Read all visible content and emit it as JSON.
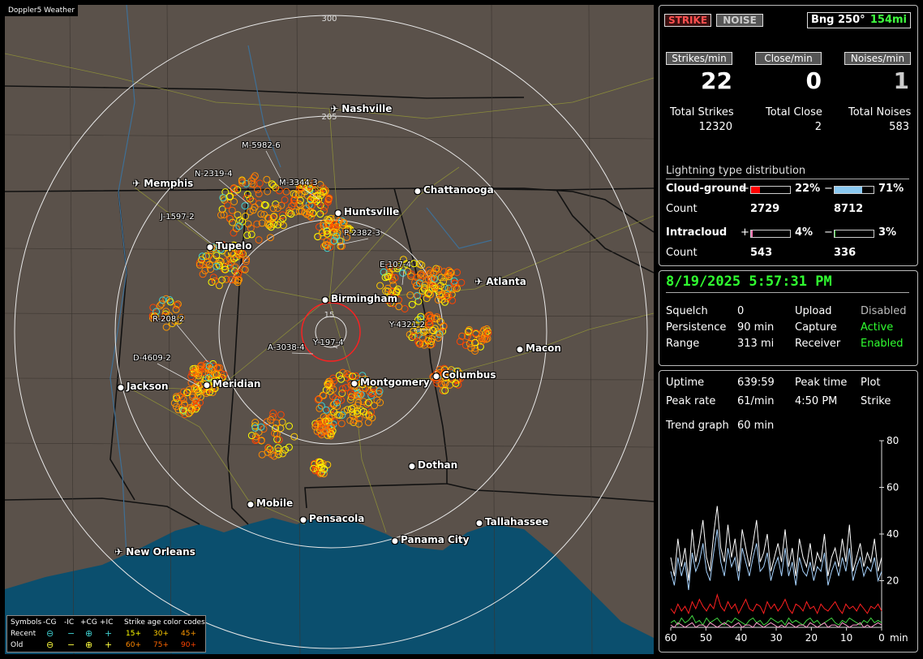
{
  "map": {
    "app_title": "Doppler5 Weather",
    "range_rings": [
      "300",
      "205",
      "15"
    ],
    "cities": [
      {
        "name": "Nashville",
        "type": "airport"
      },
      {
        "name": "Memphis",
        "type": "airport"
      },
      {
        "name": "Chattanooga",
        "type": "city"
      },
      {
        "name": "Huntsville",
        "type": "city"
      },
      {
        "name": "Tupelo",
        "type": "city"
      },
      {
        "name": "Atlanta",
        "type": "airport"
      },
      {
        "name": "Birmingham",
        "type": "city"
      },
      {
        "name": "Macon",
        "type": "city"
      },
      {
        "name": "Jackson",
        "type": "city"
      },
      {
        "name": "Meridian",
        "type": "city"
      },
      {
        "name": "Montgomery",
        "type": "city"
      },
      {
        "name": "Columbus",
        "type": "city"
      },
      {
        "name": "Dothan",
        "type": "city"
      },
      {
        "name": "Mobile",
        "type": "city"
      },
      {
        "name": "Pensacola",
        "type": "city"
      },
      {
        "name": "Tallahassee",
        "type": "city"
      },
      {
        "name": "Panama City",
        "type": "city"
      },
      {
        "name": "New Orleans",
        "type": "airport"
      }
    ],
    "storm_cells": [
      "M-5982-6",
      "N-2319-4",
      "M-3344-3",
      "J-1597-2",
      "P-2382-3",
      "E-107-4",
      "R-208-2",
      "D-4609-2",
      "Y-4321-2",
      "A-3038-4",
      "Y-197-4"
    ],
    "legend": {
      "symbols_label": "Symbols",
      "headers": [
        "-CG",
        "-IC",
        "+CG",
        "+IC"
      ],
      "recent_label": "Recent",
      "old_label": "Old",
      "age_title": "Strike age color codes",
      "recent_ages": [
        "15+",
        "30+",
        "45+"
      ],
      "old_ages": [
        "60+",
        "75+",
        "90+"
      ],
      "age_colors": [
        "#ffff00",
        "#ffcc00",
        "#ff9900",
        "#ff8800",
        "#ff6600",
        "#ff4400"
      ]
    }
  },
  "top": {
    "strike_btn": "STRIKE",
    "noise_btn": "NOISE",
    "bearing": "Bng 250°",
    "distance": "154mi",
    "strikes_min_label": "Strikes/min",
    "close_min_label": "Close/min",
    "noises_min_label": "Noises/min",
    "strikes_min": "22",
    "close_min": "0",
    "noises_min": "1",
    "total_strikes_label": "Total Strikes",
    "total_close_label": "Total Close",
    "total_noises_label": "Total Noises",
    "total_strikes": "12320",
    "total_close": "2",
    "total_noises": "583",
    "dist_title": "Lightning type distribution",
    "cg_label": "Cloud-ground",
    "ic_label": "Intracloud",
    "count_label": "Count",
    "plus": "+",
    "minus": "−",
    "cg_pos_pct": "22%",
    "cg_neg_pct": "71%",
    "ic_pos_pct": "4%",
    "ic_neg_pct": "3%",
    "cg_pos_frac": 0.22,
    "cg_neg_frac": 0.71,
    "ic_pos_frac": 0.04,
    "ic_neg_frac": 0.03,
    "cg_pos_count": "2729",
    "cg_neg_count": "8712",
    "ic_pos_count": "543",
    "ic_neg_count": "336"
  },
  "status": {
    "datetime": "8/19/2025 5:57:31 PM",
    "squelch_label": "Squelch",
    "squelch": "0",
    "upload_label": "Upload",
    "upload": "Disabled",
    "persistence_label": "Persistence",
    "persistence": "90 min",
    "capture_label": "Capture",
    "capture": "Active",
    "range_label": "Range",
    "range": "313 mi",
    "receiver_label": "Receiver",
    "receiver": "Enabled"
  },
  "trend": {
    "uptime_label": "Uptime",
    "uptime": "639:59",
    "peak_time_label": "Peak time",
    "plot_label": "Plot",
    "peak_rate_label": "Peak rate",
    "peak_rate": "61/min",
    "peak_time": "4:50 PM",
    "plot": "Strike",
    "trend_graph_label": "Trend graph",
    "trend_graph": "60 min"
  },
  "chart_data": {
    "type": "line",
    "x_ticks": [
      "60",
      "50",
      "40",
      "30",
      "20",
      "10",
      "0"
    ],
    "x_unit": "min",
    "y_ticks": [
      "80",
      "60",
      "40",
      "20"
    ],
    "ylim": [
      0,
      80
    ],
    "xlim": [
      60,
      0
    ],
    "series": [
      {
        "color": "#ffffff",
        "values": [
          30,
          22,
          38,
          26,
          34,
          20,
          42,
          28,
          36,
          46,
          30,
          24,
          40,
          52,
          34,
          28,
          44,
          30,
          38,
          24,
          42,
          34,
          26,
          36,
          46,
          28,
          32,
          40,
          24,
          30,
          36,
          28,
          42,
          26,
          34,
          22,
          38,
          30,
          26,
          36,
          24,
          32,
          28,
          40,
          22,
          30,
          34,
          26,
          38,
          28,
          44,
          24,
          30,
          36,
          26,
          32,
          28,
          38,
          24,
          30
        ]
      },
      {
        "color": "#a8d4ff",
        "values": [
          24,
          18,
          30,
          22,
          28,
          16,
          32,
          24,
          28,
          36,
          24,
          20,
          32,
          42,
          28,
          22,
          34,
          26,
          30,
          20,
          34,
          28,
          22,
          30,
          36,
          24,
          26,
          32,
          20,
          26,
          30,
          22,
          34,
          22,
          28,
          18,
          30,
          24,
          22,
          28,
          20,
          26,
          24,
          32,
          18,
          24,
          28,
          22,
          30,
          24,
          34,
          20,
          26,
          30,
          22,
          26,
          24,
          30,
          20,
          24
        ]
      },
      {
        "color": "#ff2020",
        "values": [
          8,
          6,
          10,
          7,
          9,
          6,
          11,
          8,
          12,
          9,
          7,
          10,
          8,
          14,
          9,
          7,
          11,
          8,
          10,
          6,
          9,
          12,
          8,
          7,
          10,
          9,
          6,
          11,
          8,
          10,
          7,
          9,
          12,
          8,
          6,
          10,
          9,
          7,
          11,
          8,
          9,
          6,
          10,
          8,
          7,
          9,
          11,
          8,
          6,
          10,
          8,
          9,
          7,
          10,
          8,
          6,
          9,
          8,
          10,
          7
        ]
      },
      {
        "color": "#40d040",
        "values": [
          2,
          3,
          1,
          4,
          2,
          3,
          5,
          2,
          3,
          1,
          4,
          2,
          3,
          4,
          2,
          1,
          3,
          2,
          4,
          3,
          2,
          1,
          3,
          4,
          2,
          3,
          1,
          2,
          4,
          3,
          2,
          3,
          1,
          4,
          2,
          3,
          2,
          1,
          3,
          4,
          2,
          3,
          1,
          2,
          3,
          4,
          2,
          1,
          3,
          2,
          4,
          3,
          2,
          1,
          3,
          2,
          4,
          2,
          3,
          2
        ]
      },
      {
        "color": "#ff9fd0",
        "values": [
          1,
          0,
          2,
          1,
          0,
          1,
          2,
          0,
          1,
          1,
          0,
          2,
          1,
          0,
          1,
          2,
          1,
          0,
          1,
          2,
          0,
          1,
          1,
          0,
          2,
          1,
          0,
          1,
          2,
          1,
          0,
          1,
          0,
          2,
          1,
          0,
          1,
          1,
          0,
          2,
          1,
          0,
          1,
          2,
          0,
          1,
          1,
          0,
          2,
          1,
          0,
          1,
          1,
          2,
          0,
          1,
          0,
          1,
          2,
          1
        ]
      }
    ]
  }
}
